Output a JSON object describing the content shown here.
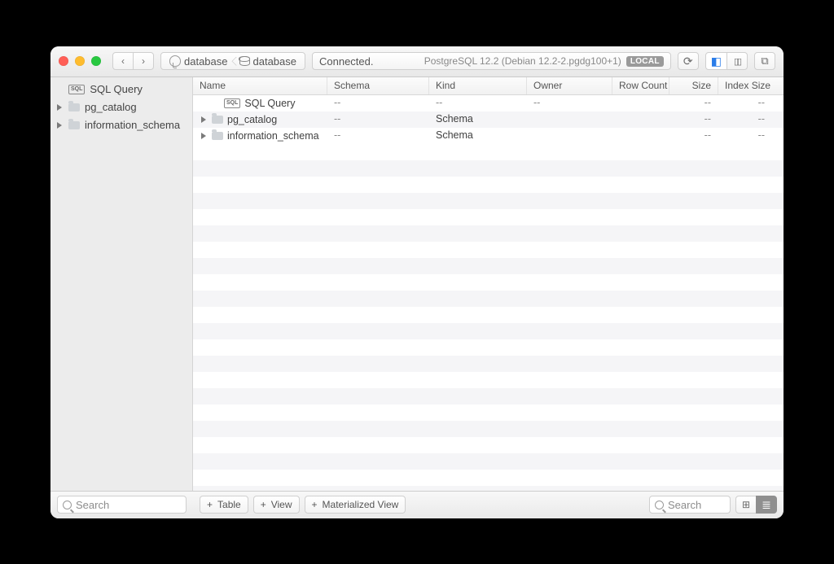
{
  "toolbar": {
    "breadcrumb": [
      {
        "icon": "elephant",
        "label": "database"
      },
      {
        "icon": "db",
        "label": "database"
      }
    ],
    "status": "Connected.",
    "server_info": "PostgreSQL 12.2 (Debian 12.2-2.pgdg100+1)",
    "server_badge": "LOCAL"
  },
  "sidebar": {
    "items": [
      {
        "icon": "sql",
        "label": "SQL Query",
        "expandable": false
      },
      {
        "icon": "folder",
        "label": "pg_catalog",
        "expandable": true
      },
      {
        "icon": "folder",
        "label": "information_schema",
        "expandable": true
      }
    ],
    "search_placeholder": "Search"
  },
  "columns": [
    "Name",
    "Schema",
    "Kind",
    "Owner",
    "Row Count",
    "Size",
    "Index Size"
  ],
  "rows": [
    {
      "name": "SQL Query",
      "icon": "sql",
      "expandable": false,
      "indent": 1,
      "schema": "--",
      "kind": "--",
      "owner": "--",
      "row_count": "",
      "size": "--",
      "index_size": "--"
    },
    {
      "name": "pg_catalog",
      "icon": "folder",
      "expandable": true,
      "indent": 0,
      "schema": "--",
      "kind": "Schema",
      "owner": "",
      "row_count": "",
      "size": "--",
      "index_size": "--"
    },
    {
      "name": "information_schema",
      "icon": "folder",
      "expandable": true,
      "indent": 0,
      "schema": "--",
      "kind": "Schema",
      "owner": "",
      "row_count": "",
      "size": "--",
      "index_size": "--"
    }
  ],
  "footer": {
    "buttons": [
      "Table",
      "View",
      "Materialized View"
    ],
    "search_placeholder": "Search"
  }
}
